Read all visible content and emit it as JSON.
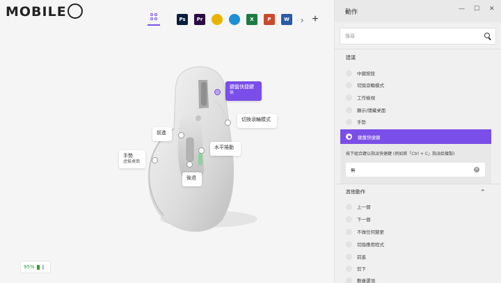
{
  "logo": {
    "text": "MOBILE"
  },
  "toolbar": {
    "apps": [
      {
        "name": "ps-app",
        "abbr": "Ps",
        "color": "#0a1f3d"
      },
      {
        "name": "pr-app",
        "abbr": "Pr",
        "color": "#2b0a45"
      },
      {
        "name": "chrome-app",
        "abbr": "",
        "color": "#e8b400"
      },
      {
        "name": "edge-app",
        "abbr": "",
        "color": "#1d8fd6"
      },
      {
        "name": "excel-app",
        "abbr": "X",
        "color": "#1d7a43"
      },
      {
        "name": "powerpoint-app",
        "abbr": "P",
        "color": "#c94a2a"
      },
      {
        "name": "word-app",
        "abbr": "W",
        "color": "#2a5aa8"
      }
    ],
    "more": "›",
    "add": "+"
  },
  "mouse": {
    "callouts": {
      "gesture": "鍵盤快捷鍵",
      "gesture_sub": "無",
      "scroll_mode": "切換滾輪模式",
      "forward": "前進",
      "horizontal": "水平捲動",
      "gesture_button": "手勢",
      "gesture_button_sub": "虛擬桌面",
      "back": "後退"
    }
  },
  "battery": {
    "level": "95%"
  },
  "panel": {
    "title": "動作",
    "window_controls": [
      "—",
      "☐",
      "✕"
    ],
    "search_placeholder": "搜尋",
    "suggested_label": "建議",
    "suggested": [
      "中鍵按鈕",
      "切換滾輪模式",
      "工作檢視",
      "顯示/隱藏桌面",
      "手勢"
    ],
    "selected": {
      "label": "鍵盤快捷鍵",
      "description": "按下組合鍵以指派快捷鍵 (例如將「Ctrl + C」指派給複製)",
      "value": "無"
    },
    "other_label": "其他動作",
    "other": [
      "上一個",
      "下一個",
      "不做任何變更",
      "切換應用程式",
      "前進",
      "剪下",
      "數複選項"
    ]
  },
  "colors": {
    "accent": "#7a4ee8",
    "battery": "#2a9d3a"
  }
}
